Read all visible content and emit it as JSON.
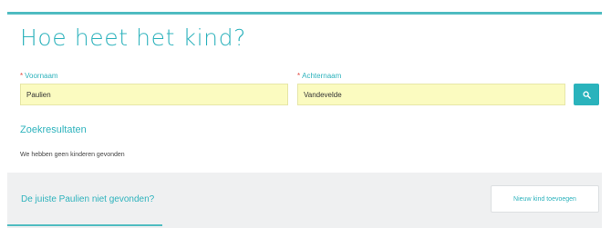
{
  "page": {
    "title": "Hoe heet het kind?"
  },
  "form": {
    "first_name": {
      "required_mark": "*",
      "label": "Voornaam",
      "value": "Paulien"
    },
    "last_name": {
      "required_mark": "*",
      "label": "Achternaam",
      "value": "Vandevelde"
    },
    "search_icon": "search-icon"
  },
  "results": {
    "heading": "Zoekresultaten",
    "empty_message": "We hebben geen kinderen gevonden"
  },
  "footer": {
    "not_found_text": "De juiste Paulien niet gevonden?",
    "add_button_label": "Nieuw kind toevoegen"
  },
  "colors": {
    "accent": "#2fb3bd",
    "required": "#e2463d",
    "input_fill": "#fbfbc0",
    "footer_bg": "#eff0f1"
  }
}
